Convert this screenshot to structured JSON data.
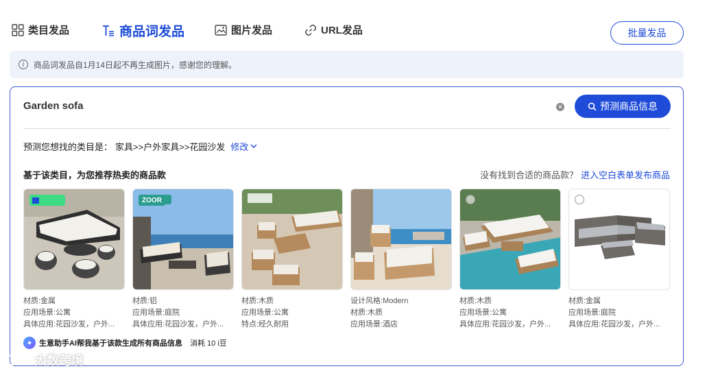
{
  "tabs": [
    {
      "label": "类目发品",
      "icon": "grid-icon",
      "active": false
    },
    {
      "label": "商品词发品",
      "icon": "text-list-icon",
      "active": true
    },
    {
      "label": "图片发品",
      "icon": "image-icon",
      "active": false
    },
    {
      "label": "URL发品",
      "icon": "link-icon",
      "active": false
    }
  ],
  "batch_button": "批量发品",
  "notice": "商品词发品自1月14日起不再生成图片，感谢您的理解。",
  "search": {
    "value": "Garden sofa",
    "button": "预测商品信息"
  },
  "category": {
    "prefix": "预测您想找的类目是：",
    "path": "家具>>户外家具>>花园沙发",
    "modify": "修改"
  },
  "recommend": {
    "title": "基于该类目，为您推荐热卖的商品款",
    "no_match_text": "没有找到合适的商品款？",
    "no_match_link": "进入空白表单发布商品"
  },
  "products": [
    {
      "attrs": [
        "材质:金属",
        "应用场景:公寓",
        "具体应用:花园沙发，户外..."
      ],
      "brand": "",
      "palette": [
        "#c9c3b8",
        "#f4f2ee",
        "#3b3b3b"
      ]
    },
    {
      "attrs": [
        "材质:铝",
        "应用场景:庭院",
        "具体应用:花园沙发，户外..."
      ],
      "brand": "ZOOR",
      "palette": [
        "#7fb0e0",
        "#efe9de",
        "#3a3a3a"
      ]
    },
    {
      "attrs": [
        "材质:木质",
        "应用场景:公寓",
        "特点:经久耐用"
      ],
      "brand": "",
      "palette": [
        "#cfc2ae",
        "#f2efe9",
        "#b58a5c"
      ]
    },
    {
      "attrs": [
        "设计风格:Modern",
        "材质:木质",
        "应用场景:酒店"
      ],
      "brand": "",
      "palette": [
        "#8cc0e8",
        "#f3f1ec",
        "#c49a6c"
      ]
    },
    {
      "attrs": [
        "材质:木质",
        "应用场景:公寓",
        "具体应用:花园沙发，户外..."
      ],
      "brand": "",
      "palette": [
        "#5a7d4f",
        "#f5f3ef",
        "#a98258"
      ]
    },
    {
      "attrs": [
        "材质:金属",
        "应用场景:庭院",
        "具体应用:花园沙发，户外..."
      ],
      "brand": "",
      "palette": [
        "#ffffff",
        "#b9bcc0",
        "#6e6a66"
      ]
    }
  ],
  "ai": {
    "text": "生意助手AI帮我基于该款生成所有商品信息",
    "cost": "消耗 10 i豆"
  },
  "watermark": "大数跨境"
}
